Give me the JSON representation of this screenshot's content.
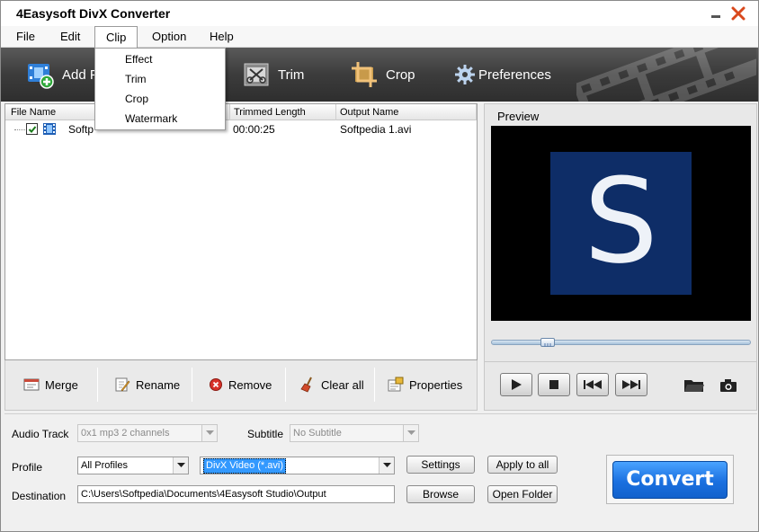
{
  "window": {
    "title": "4Easysoft DivX Converter"
  },
  "menu": {
    "items": [
      "File",
      "Edit",
      "Clip",
      "Option",
      "Help"
    ],
    "active": "Clip"
  },
  "clip_menu": {
    "items": [
      "Effect",
      "Trim",
      "Crop",
      "Watermark"
    ]
  },
  "toolbar": {
    "add_file_label": "Add F",
    "trim_label": "Trim",
    "crop_label": "Crop",
    "preferences_label": "Preferences"
  },
  "file_list": {
    "columns": {
      "file_name": "File Name",
      "trimmed_length": "Trimmed Length",
      "output_name": "Output Name"
    },
    "rows": [
      {
        "checked": true,
        "file_name": "Softp",
        "trimmed_length": "00:00:25",
        "output_name": "Softpedia 1.avi"
      }
    ]
  },
  "actions": {
    "merge": "Merge",
    "rename": "Rename",
    "remove": "Remove",
    "clear_all": "Clear all",
    "properties": "Properties"
  },
  "preview": {
    "label": "Preview",
    "logo_letter": "S",
    "seek_position": 0.2
  },
  "settings": {
    "audio_track_label": "Audio Track",
    "audio_track_value": "0x1 mp3 2 channels",
    "subtitle_label": "Subtitle",
    "subtitle_value": "No Subtitle",
    "profile_label": "Profile",
    "profile_category": "All Profiles",
    "profile_value": "DivX Video (*.avi)",
    "settings_button": "Settings",
    "apply_to_all_button": "Apply to all",
    "destination_label": "Destination",
    "destination_value": "C:\\Users\\Softpedia\\Documents\\4Easysoft Studio\\Output",
    "browse_button": "Browse",
    "open_folder_button": "Open Folder",
    "convert_button": "Convert"
  },
  "colors": {
    "accent": "#1a70e0",
    "toolbar_bg": "#3c3c3c",
    "logo_bg": "#0e2d67"
  }
}
